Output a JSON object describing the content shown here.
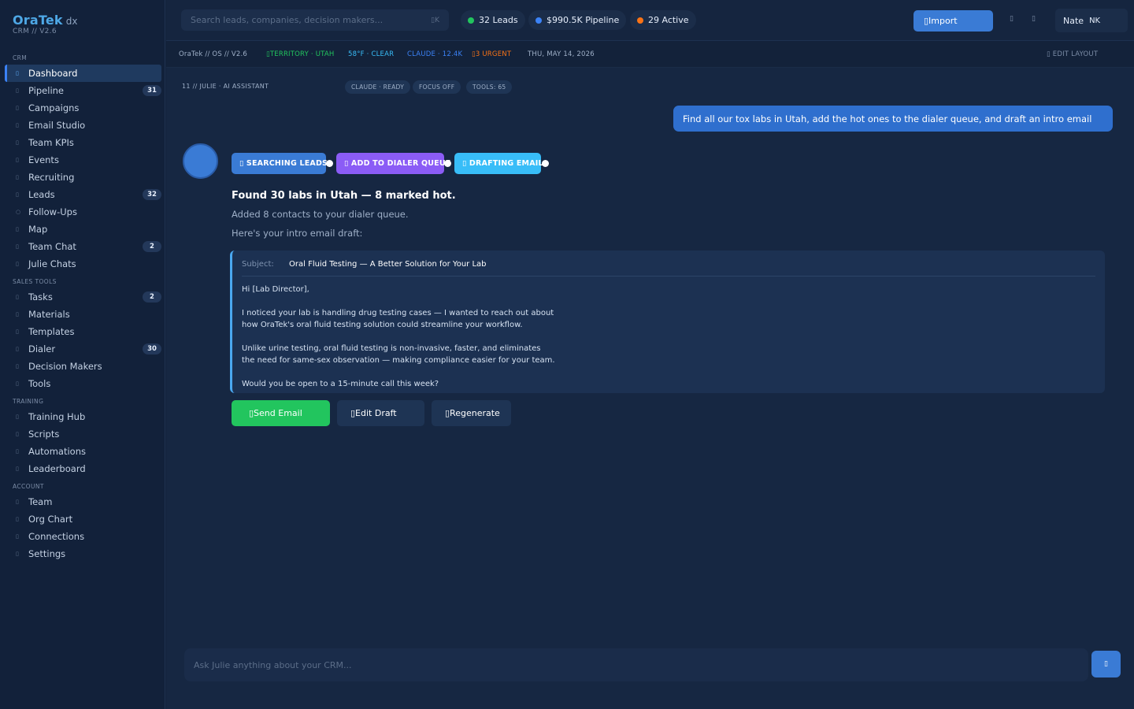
{
  "brand": {
    "logo": "OraTek",
    "suffix": "dx",
    "version": "CRM // V2.6"
  },
  "sidebar": {
    "sections": [
      "CRM",
      "SALES TOOLS",
      "TRAINING",
      "ACCOUNT"
    ],
    "items": [
      {
        "label": "Dashboard",
        "icon": "▯",
        "active": true
      },
      {
        "label": "Pipeline",
        "icon": "▯",
        "count": "31"
      },
      {
        "label": "Campaigns",
        "icon": "▯"
      },
      {
        "label": "Email Studio",
        "icon": "▯"
      },
      {
        "label": "Team KPIs",
        "icon": "▯"
      },
      {
        "label": "Events",
        "icon": "▯"
      },
      {
        "label": "Recruiting",
        "icon": "▯"
      },
      {
        "label": "Leads",
        "icon": "▯",
        "count": "32"
      },
      {
        "label": "Follow-Ups",
        "icon": "○"
      },
      {
        "label": "Map",
        "icon": "▯"
      },
      {
        "label": "Team Chat",
        "icon": "▯",
        "count": "2"
      },
      {
        "label": "Julie Chats",
        "icon": "▯"
      },
      {
        "label": "Tasks",
        "icon": "▯",
        "count": "2"
      },
      {
        "label": "Materials",
        "icon": "▯"
      },
      {
        "label": "Templates",
        "icon": "▯"
      },
      {
        "label": "Dialer",
        "icon": "▯",
        "count": "30"
      },
      {
        "label": "Decision Makers",
        "icon": "▯"
      },
      {
        "label": "Tools",
        "icon": "▯"
      },
      {
        "label": "Training Hub",
        "icon": "▯"
      },
      {
        "label": "Scripts",
        "icon": "▯"
      },
      {
        "label": "Automations",
        "icon": "▯"
      },
      {
        "label": "Leaderboard",
        "icon": "▯"
      },
      {
        "label": "Team",
        "icon": "▯"
      },
      {
        "label": "Org Chart",
        "icon": "▯"
      },
      {
        "label": "Connections",
        "icon": "▯"
      },
      {
        "label": "Settings",
        "icon": "▯"
      }
    ]
  },
  "topbar": {
    "search_placeholder": "Search leads, companies, decision makers...",
    "search_shortcut": "▯K",
    "stats": [
      {
        "label": "32 Leads",
        "color": "#22c55e"
      },
      {
        "label": "$990.5K Pipeline",
        "color": "#3b82f6"
      },
      {
        "label": "29 Active",
        "color": "#f97316"
      }
    ],
    "import_label": "▯Import",
    "icon_a": "▯",
    "icon_b": "▯",
    "user_name": "Nate",
    "user_initials": "NK"
  },
  "statusbar": {
    "os": "OraTek // OS // V2.6",
    "territory": "▯TERRITORY · UTAH",
    "weather": "58°F · CLEAR",
    "claude": "CLAUDE · 12.4K",
    "urgent": "▯3 URGENT",
    "date": "THU, MAY 14, 2026",
    "edit_layout": "▯ EDIT LAYOUT",
    "colors": {
      "territory": "#22c55e",
      "weather": "#38bdf8",
      "claude": "#3b82f6",
      "urgent": "#f97316"
    }
  },
  "assistant": {
    "label": "11 // JULIE · AI ASSISTANT",
    "tags": [
      "CLAUDE · READY",
      "FOCUS OFF",
      "TOOLS: 65"
    ]
  },
  "chat": {
    "user_message": "Find all our tox labs in Utah, add the hot ones to the dialer queue, and draft an intro email",
    "steps": [
      {
        "label": "▯ SEARCHING LEADS",
        "color": "#3a7bd5"
      },
      {
        "label": "▯ ADD TO DIALER QUEUE",
        "color": "#8b5cf6"
      },
      {
        "label": "▯ DRAFTING EMAIL",
        "color": "#38bdf8"
      }
    ],
    "result_title": "Found 30 labs in Utah — 8 marked hot.",
    "result_line1": "Added 8 contacts to your dialer queue.",
    "result_line2": "Here's your intro email draft:",
    "email": {
      "subject_label": "Subject:",
      "subject": "Oral Fluid Testing — A Better Solution for Your Lab",
      "lines": [
        "Hi [Lab Director],",
        "I noticed your lab is handling drug testing cases — I wanted to reach out about",
        "how OraTek's oral fluid testing solution could streamline your workflow.",
        "Unlike urine testing, oral fluid testing is non-invasive, faster, and eliminates",
        "the need for same-sex observation — making compliance easier for your team.",
        "Would you be open to a 15-minute call this week?"
      ]
    },
    "actions": {
      "send": "▯Send Email",
      "edit": "▯Edit Draft",
      "regenerate": "▯Regenerate"
    }
  },
  "composer": {
    "placeholder": "Ask Julie anything about your CRM...",
    "send_icon": "▯"
  }
}
